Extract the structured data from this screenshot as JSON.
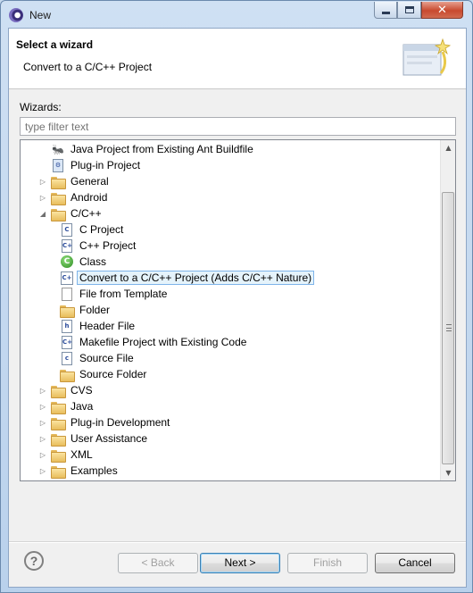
{
  "window": {
    "title": "New",
    "close_glyph": "✕"
  },
  "banner": {
    "title": "Select a wizard",
    "message": "Convert to a C/C++ Project"
  },
  "wizards_label": "Wizards:",
  "filter": {
    "placeholder": "type filter text"
  },
  "tree": {
    "rows": [
      {
        "label": "Java Project from Existing Ant Buildfile",
        "icon": "ant-icon",
        "expander": ""
      },
      {
        "label": "Plug-in Project",
        "icon": "plugin-project-icon",
        "expander": ""
      },
      {
        "label": "General",
        "icon": "folder-icon",
        "expander": "▷"
      },
      {
        "label": "Android",
        "icon": "folder-icon",
        "expander": "▷"
      },
      {
        "label": "C/C++",
        "icon": "folder-icon",
        "expander": "◢"
      },
      {
        "label": "C Project",
        "icon": "c-project-icon",
        "expander": ""
      },
      {
        "label": "C++ Project",
        "icon": "cpp-project-icon",
        "expander": ""
      },
      {
        "label": "Class",
        "icon": "class-icon",
        "expander": ""
      },
      {
        "label": "Convert to a C/C++ Project (Adds C/C++ Nature)",
        "icon": "convert-icon",
        "expander": "",
        "selected": true
      },
      {
        "label": "File from Template",
        "icon": "file-template-icon",
        "expander": ""
      },
      {
        "label": "Folder",
        "icon": "folder-icon",
        "expander": ""
      },
      {
        "label": "Header File",
        "icon": "header-file-icon",
        "expander": ""
      },
      {
        "label": "Makefile Project with Existing Code",
        "icon": "makefile-icon",
        "expander": ""
      },
      {
        "label": "Source File",
        "icon": "source-file-icon",
        "expander": ""
      },
      {
        "label": "Source Folder",
        "icon": "source-folder-icon",
        "expander": ""
      },
      {
        "label": "CVS",
        "icon": "folder-icon",
        "expander": "▷"
      },
      {
        "label": "Java",
        "icon": "folder-icon",
        "expander": "▷"
      },
      {
        "label": "Plug-in Development",
        "icon": "folder-icon",
        "expander": "▷"
      },
      {
        "label": "User Assistance",
        "icon": "folder-icon",
        "expander": "▷"
      },
      {
        "label": "XML",
        "icon": "folder-icon",
        "expander": "▷"
      },
      {
        "label": "Examples",
        "icon": "folder-icon",
        "expander": "▷"
      }
    ]
  },
  "buttons": {
    "help": "?",
    "back": "< Back",
    "next": "Next >",
    "finish": "Finish",
    "cancel": "Cancel"
  },
  "scrollbar": {
    "up": "▲",
    "down": "▼"
  }
}
